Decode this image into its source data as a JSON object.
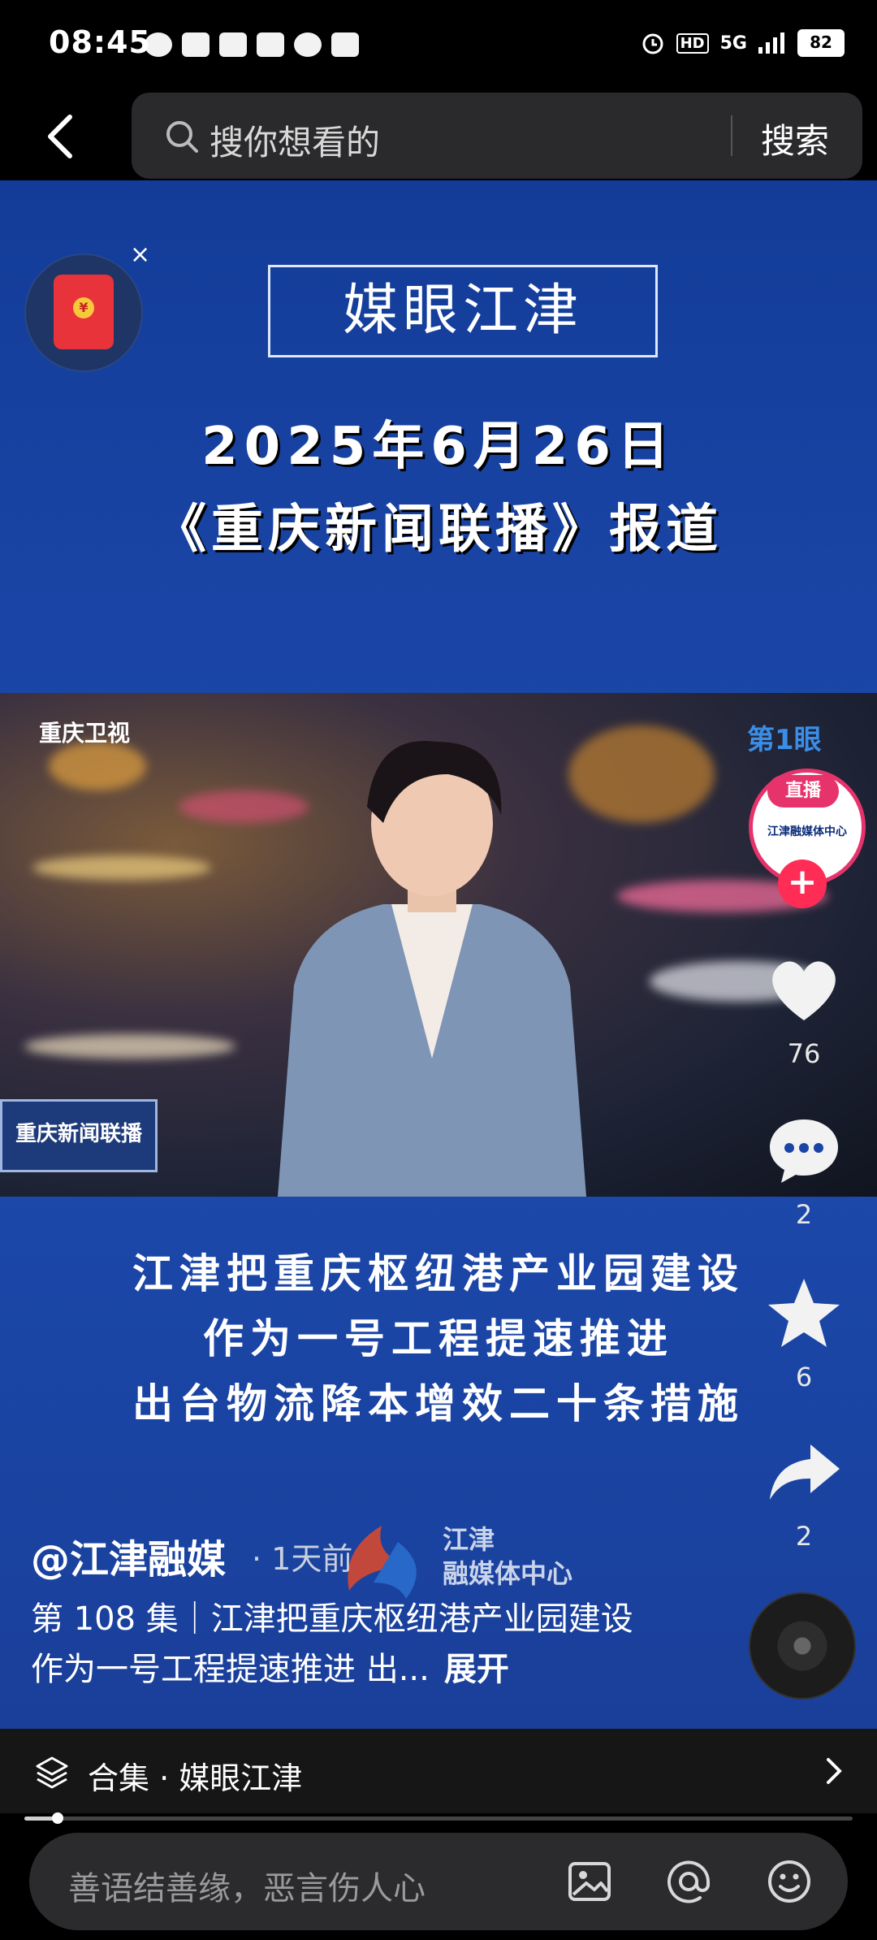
{
  "status": {
    "time": "08:45",
    "battery": "82",
    "network": "5G",
    "hd": "HD"
  },
  "search": {
    "placeholder": "搜你想看的",
    "submit": "搜索"
  },
  "video": {
    "title": "媒眼江津",
    "date": "2025年6月26日",
    "program": "《重庆新闻联播》报道",
    "station_logo": "重庆卫视",
    "station_mark": "第1眼",
    "lower_third": "重庆新闻联播",
    "captions": [
      "江津把重庆枢纽港产业园建设",
      "作为一号工程提速推进",
      "出台物流降本增效二十条措施"
    ],
    "watermark": {
      "line1": "江津",
      "line2": "融媒体中心"
    }
  },
  "rail": {
    "live": "直播",
    "avatar_text": "江津融媒体中心",
    "likes": "76",
    "comments": "2",
    "favorites": "6",
    "shares": "2"
  },
  "post": {
    "author": "@江津融媒",
    "time_ago": "· 1天前",
    "description": "第 108 集｜江津把重庆枢纽港产业园建设 作为一号工程提速推进 出...",
    "expand": "展开"
  },
  "collection": {
    "label": "合集 · 媒眼江津",
    "progress": 0.04
  },
  "comment": {
    "placeholder": "善语结善缘，恶言伤人心"
  },
  "colors": {
    "accent_pink": "#e6336b",
    "video_blue": "#1a45a6"
  }
}
